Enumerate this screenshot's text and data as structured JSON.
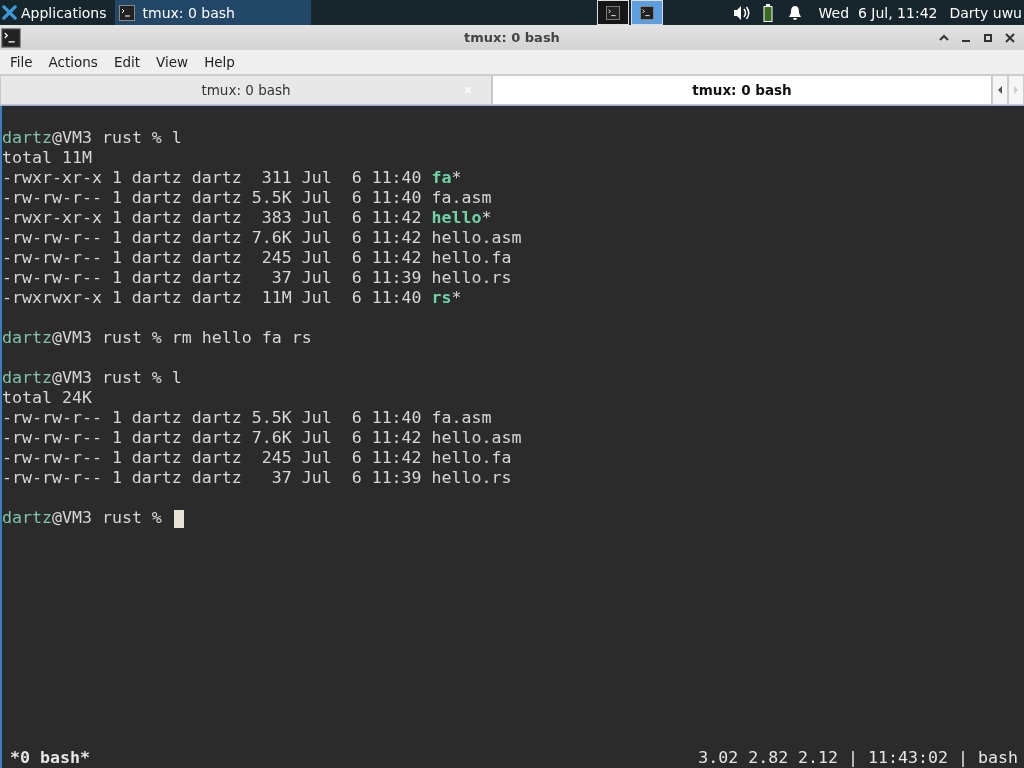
{
  "panel": {
    "apps_label": "Applications",
    "tasks": [
      {
        "label": "tmux: 0 bash",
        "selected": true
      }
    ],
    "workspaces": [
      {
        "selected": false
      },
      {
        "selected": true
      }
    ],
    "clock": "Wed  6 Jul, 11:42",
    "user": "Darty uwu"
  },
  "window": {
    "title": "tmux: 0 bash"
  },
  "menu": [
    "File",
    "Actions",
    "Edit",
    "View",
    "Help"
  ],
  "tabs": [
    {
      "label": "tmux: 0 bash",
      "selected": false
    },
    {
      "label": "tmux: 0 bash",
      "selected": true
    }
  ],
  "terminal": {
    "lines": [
      {
        "kind": "prompt",
        "user": "dartz",
        "rest": "@VM3 rust % ",
        "command": "l",
        "cursor": false
      },
      {
        "kind": "output",
        "text": "total 11M"
      },
      {
        "kind": "listing",
        "text": "-rwxr-xr-x 1 dartz dartz  311 Jul  6 11:40 ",
        "name": "fa",
        "suffix": "*",
        "executable": true
      },
      {
        "kind": "listing",
        "text": "-rw-rw-r-- 1 dartz dartz 5.5K Jul  6 11:40 ",
        "name": "fa.asm",
        "executable": false
      },
      {
        "kind": "listing",
        "text": "-rwxr-xr-x 1 dartz dartz  383 Jul  6 11:42 ",
        "name": "hello",
        "suffix": "*",
        "executable": true
      },
      {
        "kind": "listing",
        "text": "-rw-rw-r-- 1 dartz dartz 7.6K Jul  6 11:42 ",
        "name": "hello.asm",
        "executable": false
      },
      {
        "kind": "listing",
        "text": "-rw-rw-r-- 1 dartz dartz  245 Jul  6 11:42 ",
        "name": "hello.fa",
        "executable": false
      },
      {
        "kind": "listing",
        "text": "-rw-rw-r-- 1 dartz dartz   37 Jul  6 11:39 ",
        "name": "hello.rs",
        "executable": false
      },
      {
        "kind": "listing",
        "text": "-rwxrwxr-x 1 dartz dartz  11M Jul  6 11:40 ",
        "name": "rs",
        "suffix": "*",
        "executable": true
      },
      {
        "kind": "blank"
      },
      {
        "kind": "prompt",
        "user": "dartz",
        "rest": "@VM3 rust % ",
        "command": "rm hello fa rs",
        "cursor": false
      },
      {
        "kind": "blank"
      },
      {
        "kind": "prompt",
        "user": "dartz",
        "rest": "@VM3 rust % ",
        "command": "l",
        "cursor": false
      },
      {
        "kind": "output",
        "text": "total 24K"
      },
      {
        "kind": "listing",
        "text": "-rw-rw-r-- 1 dartz dartz 5.5K Jul  6 11:40 ",
        "name": "fa.asm",
        "executable": false
      },
      {
        "kind": "listing",
        "text": "-rw-rw-r-- 1 dartz dartz 7.6K Jul  6 11:42 ",
        "name": "hello.asm",
        "executable": false
      },
      {
        "kind": "listing",
        "text": "-rw-rw-r-- 1 dartz dartz  245 Jul  6 11:42 ",
        "name": "hello.fa",
        "executable": false
      },
      {
        "kind": "listing",
        "text": "-rw-rw-r-- 1 dartz dartz   37 Jul  6 11:39 ",
        "name": "hello.rs",
        "executable": false
      },
      {
        "kind": "blank"
      },
      {
        "kind": "prompt",
        "user": "dartz",
        "rest": "@VM3 rust % ",
        "cursor": true
      }
    ]
  },
  "status_bar": {
    "window_list": "*0 bash*",
    "load": "3.02 2.82 2.12",
    "time": "11:43:02",
    "host": "bash",
    "separator": "|"
  }
}
